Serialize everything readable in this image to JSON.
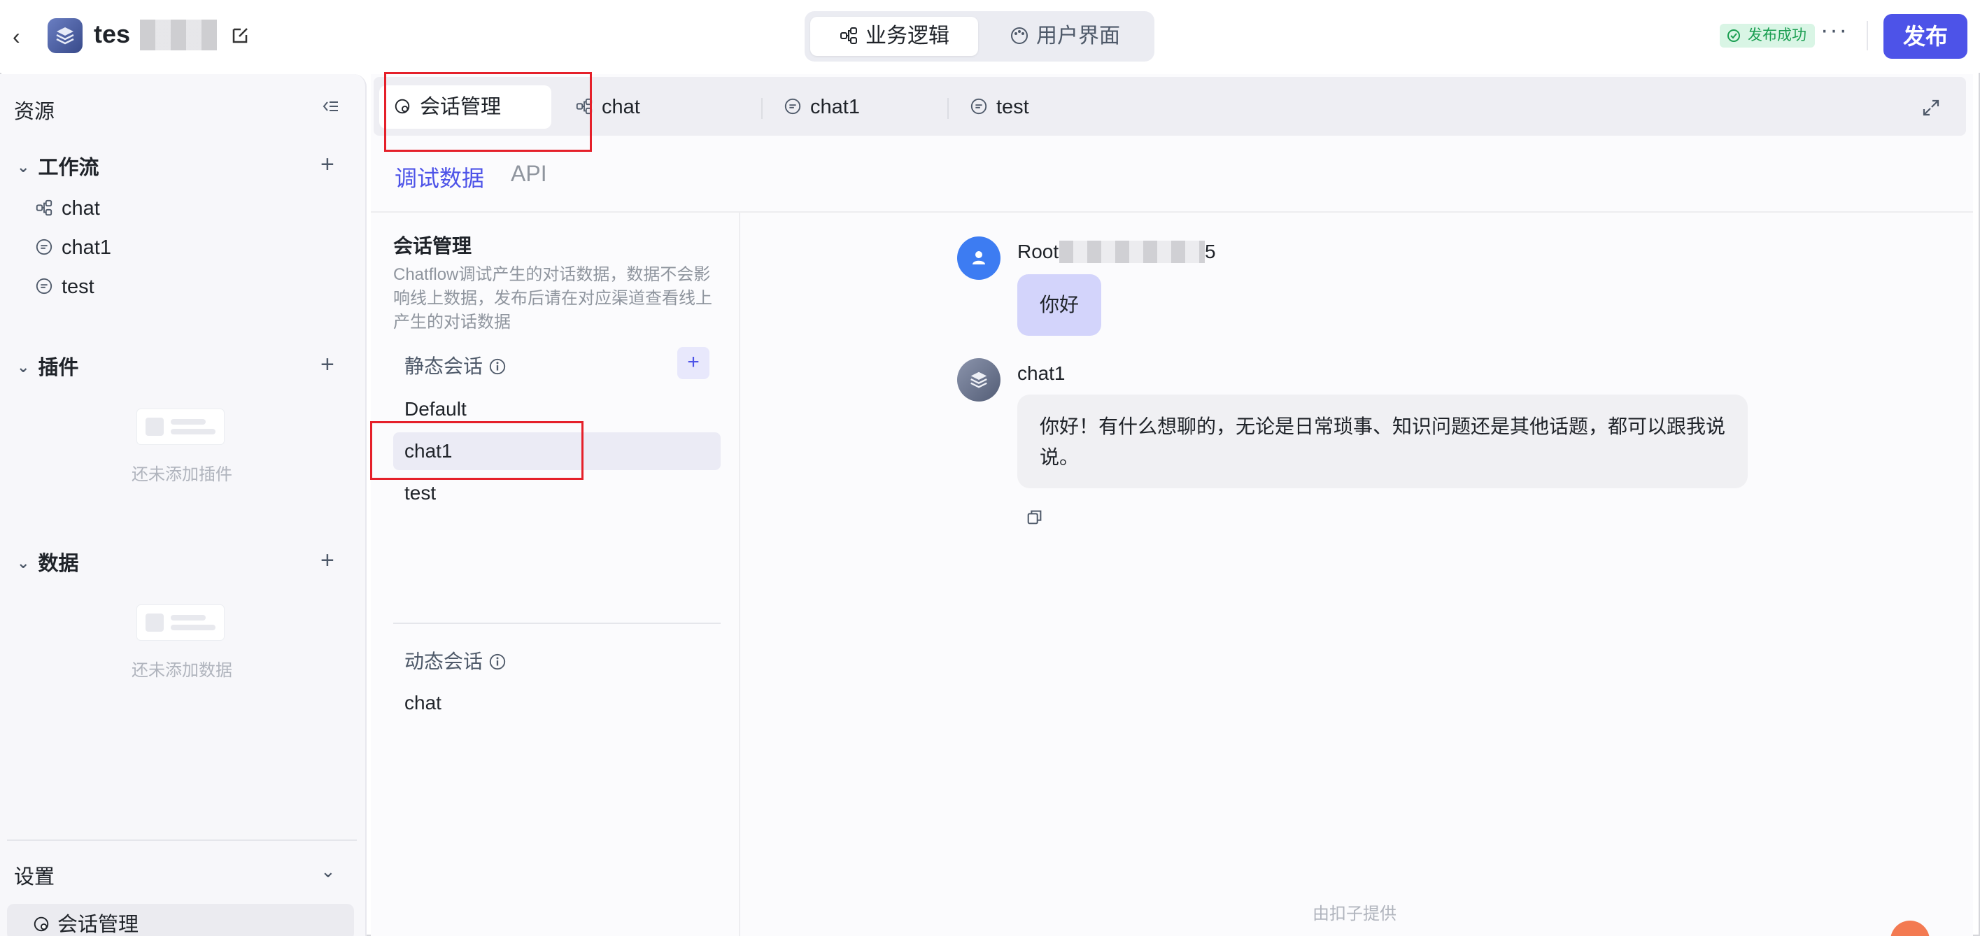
{
  "header": {
    "app_name": "tes",
    "segments": [
      {
        "label": "业务逻辑",
        "active": true
      },
      {
        "label": "用户界面",
        "active": false
      }
    ],
    "status": "发布成功",
    "more": "···",
    "publish_label": "发布"
  },
  "sidebar": {
    "title": "资源",
    "workflow": {
      "title": "工作流",
      "items": [
        "chat",
        "chat1",
        "test"
      ]
    },
    "plugins": {
      "title": "插件",
      "empty": "还未添加插件"
    },
    "data": {
      "title": "数据",
      "empty": "还未添加数据"
    },
    "settings": {
      "title": "设置",
      "item": "会话管理"
    }
  },
  "tabs": [
    {
      "label": "会话管理",
      "active": true
    },
    {
      "label": "chat"
    },
    {
      "label": "chat1"
    },
    {
      "label": "test"
    }
  ],
  "subtabs": [
    {
      "label": "调试数据",
      "active": true
    },
    {
      "label": "API"
    }
  ],
  "conversation_panel": {
    "title": "会话管理",
    "description": "Chatflow调试产生的对话数据，数据不会影响线上数据，发布后请在对应渠道查看线上产生的对话数据",
    "static_label": "静态会话",
    "static_items": [
      "Default",
      "chat1",
      "test"
    ],
    "selected": "chat1",
    "dynamic_label": "动态会话",
    "dynamic_items": [
      "chat"
    ]
  },
  "chat": {
    "user_name_prefix": "Root",
    "user_name_suffix": "5",
    "user_message": "你好",
    "bot_name": "chat1",
    "bot_message": "你好！有什么想聊的，无论是日常琐事、知识问题还是其他话题，都可以跟我说说。",
    "footer": "由扣子提供"
  },
  "colors": {
    "accent": "#4d53e8",
    "status_green": "#1a9e51",
    "highlight_red": "#e5202a"
  }
}
